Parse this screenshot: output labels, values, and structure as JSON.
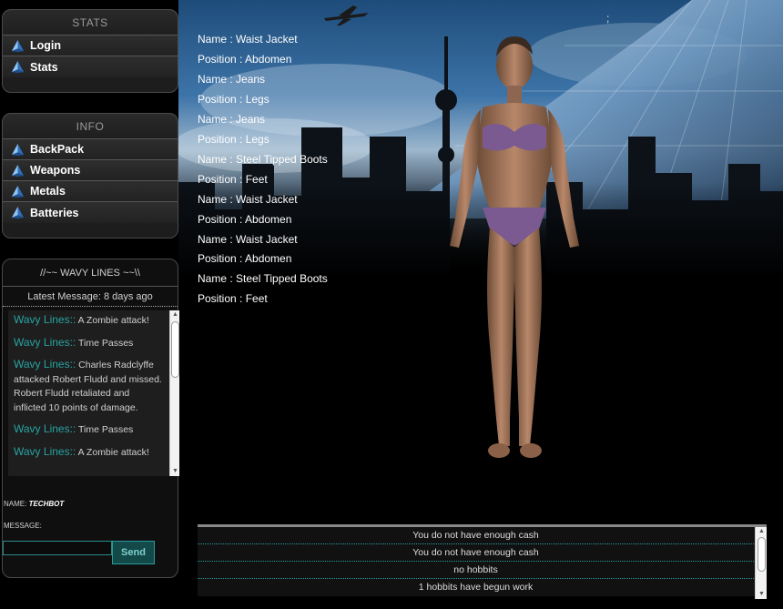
{
  "stats_panel": {
    "title": "STATS",
    "items": [
      {
        "label": "Login",
        "icon": "pyramid-icon"
      },
      {
        "label": "Stats",
        "icon": "pyramid-icon"
      }
    ]
  },
  "info_panel": {
    "title": "INFO",
    "items": [
      {
        "label": "BackPack",
        "icon": "pyramid-icon"
      },
      {
        "label": "Weapons",
        "icon": "pyramid-icon"
      },
      {
        "label": "Metals",
        "icon": "pyramid-icon"
      },
      {
        "label": "Batteries",
        "icon": "pyramid-icon"
      }
    ]
  },
  "chat": {
    "title": "//~~ WAVY LINES ~~\\\\",
    "latest": "Latest Message: 8 days ago",
    "messages": [
      {
        "who": "Wavy Lines::",
        "text": "A Zombie attack!"
      },
      {
        "who": "Wavy Lines::",
        "text": "Time Passes"
      },
      {
        "who": "Wavy Lines::",
        "text": "Charles Radclyffe attacked Robert Fludd and missed. Robert Fludd retaliated and inflicted 10 points of damage."
      },
      {
        "who": "Wavy Lines::",
        "text": "Time Passes"
      },
      {
        "who": "Wavy Lines::",
        "text": "A Zombie attack!"
      }
    ],
    "name_label": "NAME:",
    "name_value": "TECHBOT",
    "message_label": "MESSAGE:",
    "message_value": "",
    "send_label": "Send"
  },
  "equipment": [
    {
      "name_label": "Name : ",
      "name": "Waist Jacket",
      "pos_label": "Position : ",
      "position": "Abdomen"
    },
    {
      "name_label": "Name : ",
      "name": "Jeans",
      "pos_label": "Position : ",
      "position": "Legs"
    },
    {
      "name_label": "Name : ",
      "name": "Jeans",
      "pos_label": "Position : ",
      "position": "Legs"
    },
    {
      "name_label": "Name : ",
      "name": "Steel Tipped Boots",
      "pos_label": "Position : ",
      "position": "Feet"
    },
    {
      "name_label": "Name : ",
      "name": "Waist Jacket",
      "pos_label": "Position : ",
      "position": "Abdomen"
    },
    {
      "name_label": "Name : ",
      "name": "Waist Jacket",
      "pos_label": "Position : ",
      "position": "Abdomen"
    },
    {
      "name_label": "Name : ",
      "name": "Steel Tipped Boots",
      "pos_label": "Position : ",
      "position": "Feet"
    }
  ],
  "log": [
    "You do not have enough cash",
    "You do not have enough cash",
    "no hobbits",
    "1 hobbits have begun work"
  ],
  "header_mark": ";",
  "colors": {
    "accent": "#28a3a3",
    "panel_bg": "#1d1d1d",
    "icon_blue": "#5aa0e8"
  }
}
